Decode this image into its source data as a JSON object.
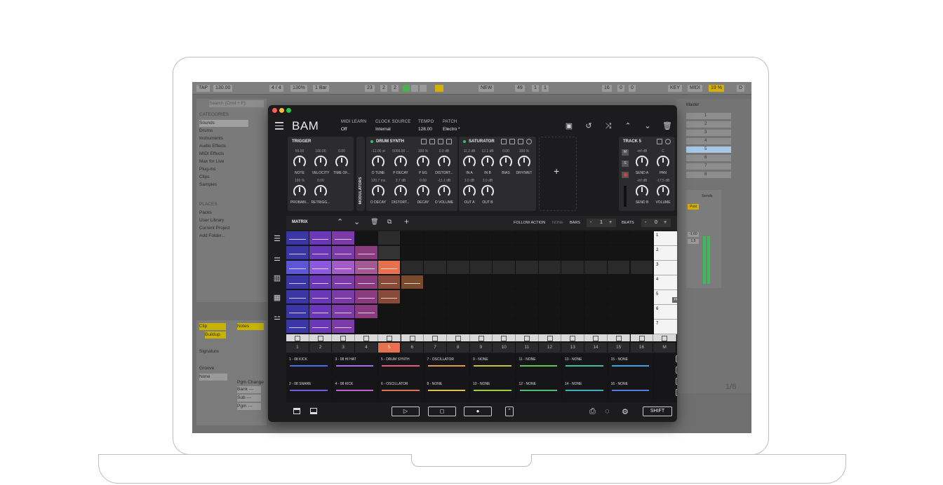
{
  "app": {
    "title": "BAM"
  },
  "header": {
    "midi_learn": {
      "label": "MIDI LEARN",
      "value": "Off"
    },
    "clock_source": {
      "label": "CLOCK SOURCE",
      "value": "Internal"
    },
    "tempo": {
      "label": "TEMPO",
      "value": "128.00"
    },
    "patch": {
      "label": "PATCH",
      "value": "Electro *"
    }
  },
  "panels": {
    "trigger": {
      "title": "TRIGGER",
      "knobs": [
        {
          "value": "50.00",
          "label": "NOTE"
        },
        {
          "value": "100.00",
          "label": "VELOCITY"
        },
        {
          "value": "0.00",
          "label": "TIME OF..."
        },
        {
          "value": "100 %",
          "label": "PROBABI..."
        },
        {
          "value": "0.00",
          "label": "RETRIGG..."
        }
      ]
    },
    "modulators_label": "MODULATORS",
    "drum_synth": {
      "title": "DRUM SYNTH",
      "knobs": [
        {
          "value": "-12.00 st",
          "label": "O TUNE"
        },
        {
          "value": "5000.00 ...",
          "label": "P DECAY"
        },
        {
          "value": "100 %",
          "label": "P EG"
        },
        {
          "value": "0.0 dB",
          "label": "DISTORT..."
        },
        {
          "value": "120.7 ms",
          "label": "O DECAY"
        },
        {
          "value": "3.7 dB",
          "label": "DISTORT..."
        },
        {
          "value": "0.60",
          "label": "DECAY"
        },
        {
          "value": "-11.1 dB",
          "label": "O VOLUME"
        }
      ]
    },
    "saturator": {
      "title": "SATURATOR",
      "knobs": [
        {
          "value": "11.2 dB",
          "label": "IN A"
        },
        {
          "value": "12.1 dB",
          "label": "IN B"
        },
        {
          "value": "0.00",
          "label": "BIAS"
        },
        {
          "value": "100 %",
          "label": "DRY/WET"
        },
        {
          "value": "3.0 dB",
          "label": "OUT A"
        },
        {
          "value": "3.0 dB",
          "label": "OUT B"
        }
      ]
    },
    "add_label": "+",
    "track": {
      "title": "TRACK 5",
      "m": "M",
      "s": "S",
      "knobs": [
        {
          "value": "-inf dB",
          "label": "SEND A"
        },
        {
          "value": "C",
          "label": "PAN"
        },
        {
          "value": "-inf dB",
          "label": "SEND B"
        },
        {
          "value": "-17.5 dB",
          "label": "VOLUME"
        }
      ]
    }
  },
  "matrix": {
    "title": "MATRIX",
    "follow_action": {
      "label": "FOLLOW ACTION",
      "value": "NONE"
    },
    "bars": {
      "label": "BARS",
      "minus": "-",
      "value": "1",
      "plus": "+"
    },
    "beats": {
      "label": "BEATS",
      "minus": "-",
      "value": "0",
      "plus": "+"
    },
    "columns": [
      "1",
      "2",
      "3",
      "4",
      "5",
      "6",
      "7",
      "8",
      "9",
      "10",
      "11",
      "12",
      "13",
      "14",
      "15",
      "16",
      "M"
    ],
    "rows": [
      "1",
      "2",
      "3",
      "4",
      "5",
      "6",
      "7"
    ],
    "row5_badge": "PR",
    "colors": [
      "#3b36a6",
      "#6a37b9",
      "#7b3aa8",
      "#8a3a7e",
      "#8a4a3a",
      "#7a4a2e",
      "#6d5a22"
    ]
  },
  "tracks": [
    {
      "name": "1 - 08 KICK",
      "color": "#4b6cf0"
    },
    {
      "name": "3 - 08 HI HAT",
      "color": "#a46cf0"
    },
    {
      "name": "5 - DRUM SYNTH",
      "color": "#e0607a"
    },
    {
      "name": "7 - OSCILLATOR",
      "color": "#e09a50"
    },
    {
      "name": "9 - NONE",
      "color": "#c8c040"
    },
    {
      "name": "11 - NONE",
      "color": "#6ac050"
    },
    {
      "name": "13 - NONE",
      "color": "#40c0a0"
    },
    {
      "name": "15 - NONE",
      "color": "#40a0e0"
    },
    {
      "name": "2 - 08 SNARE",
      "color": "#6a60e0"
    },
    {
      "name": "4 - 08 KICK",
      "color": "#c060d0"
    },
    {
      "name": "6 - OSCILLATOR",
      "color": "#e07060"
    },
    {
      "name": "8 - NONE",
      "color": "#e0c050"
    },
    {
      "name": "10 - NONE",
      "color": "#a0d040"
    },
    {
      "name": "12 - NONE",
      "color": "#50c070"
    },
    {
      "name": "14 - NONE",
      "color": "#40b0c0"
    },
    {
      "name": "16 - NONE",
      "color": "#5080e0"
    }
  ],
  "track_buttons": [
    "XFD",
    "SOLO",
    "MUTE",
    "ARM"
  ],
  "footer": {
    "shift": "SHIFT"
  },
  "ableton": {
    "tap": "TAP",
    "tempo": "130.00",
    "sig": "4 / 4",
    "zoom": "130%",
    "bar": "1 Bar",
    "pos1": "23",
    "pos2": "2",
    "pos3": "2",
    "pos4": "49",
    "pos5": "1",
    "pos6": "1",
    "pos7": "16",
    "pos8": "0",
    "pos9": "0",
    "new": "NEW",
    "key": "KEY",
    "midi": "MIDI",
    "cpu": "19 %",
    "d": "D",
    "search": "Search (Cmd + F)",
    "categories": "CATEGORIES",
    "cat_items": [
      "Sounds",
      "Drums",
      "Instruments",
      "Audio Effects",
      "MIDI Effects",
      "Max for Live",
      "Plug-ins",
      "Clips",
      "Samples"
    ],
    "places": "PLACES",
    "place_items": [
      "Packs",
      "User Library",
      "Current Project",
      "Add Folder..."
    ],
    "master": "Master",
    "master_rows": [
      "1",
      "2",
      "3",
      "4",
      "5",
      "6",
      "7",
      "8"
    ],
    "clip": "Clip",
    "notes": "Notes",
    "buildup": "Buildup",
    "signature": "Signature",
    "groove": "Groove",
    "none": "None",
    "pgm": "Pgm Change",
    "bank": "Bank ---",
    "sub": "Sub ---",
    "pgm2": "Pgm ---",
    "sends": "Sends",
    "post": "Post",
    "solo_a": "Solo",
    "db1": "-1.60",
    "db2": "1.5",
    "meter": [
      "0",
      "6",
      "12",
      "18",
      "24",
      "30",
      "36",
      "48"
    ],
    "ratio": "1/8"
  }
}
